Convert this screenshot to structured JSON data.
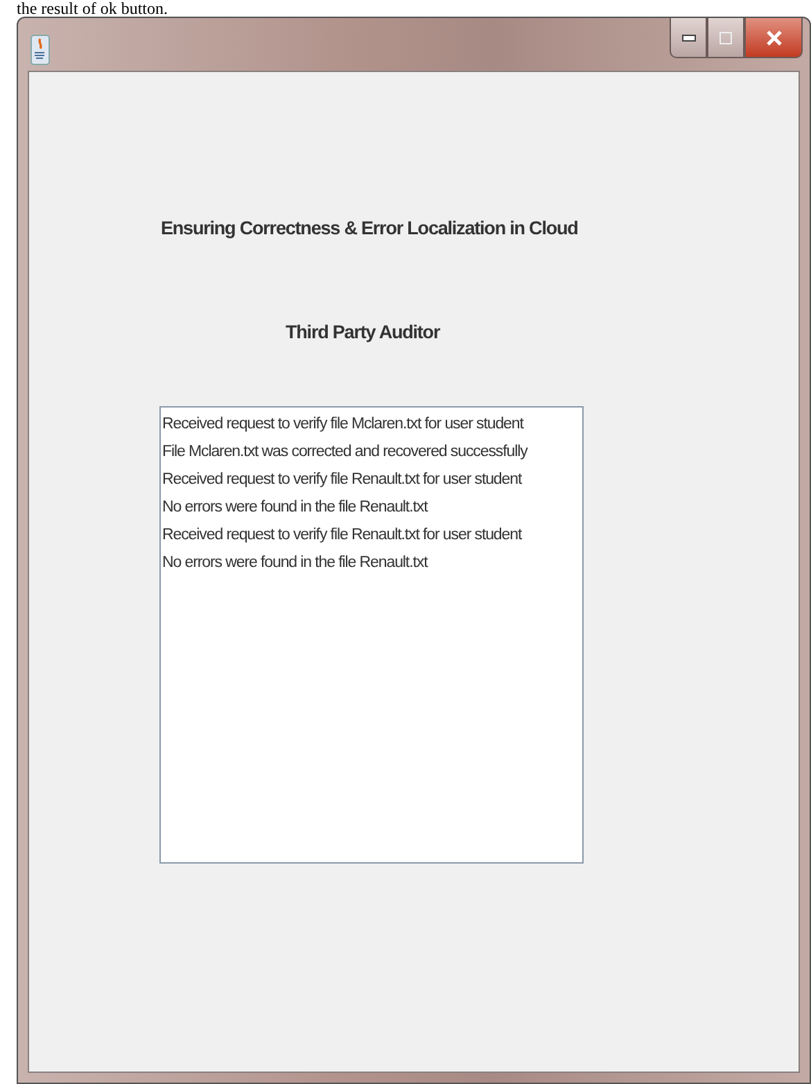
{
  "caption": "the result of ok button.",
  "window": {
    "title_bar": {
      "buttons": [
        {
          "kind": "minimize"
        },
        {
          "kind": "maximize"
        },
        {
          "kind": "close"
        }
      ]
    }
  },
  "heading": "Ensuring Correctness & Error Localization in Cloud",
  "subheading": "Third Party Auditor",
  "log": [
    "Received request to verify file Mclaren.txt for user student",
    "File Mclaren.txt was corrected and recovered successfully",
    "Received request to verify file Renault.txt for user student",
    "No errors were found in the file Renault.txt",
    "Received request to verify file Renault.txt for user student",
    "No errors were found in the file Renault.txt"
  ]
}
